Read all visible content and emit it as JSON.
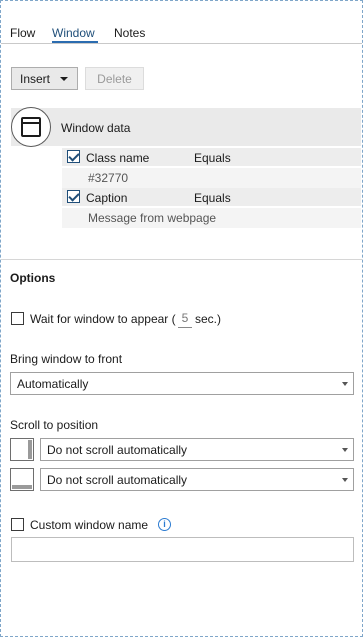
{
  "tabs": [
    {
      "label": "Flow",
      "active": false
    },
    {
      "label": "Window",
      "active": true
    },
    {
      "label": "Notes",
      "active": false
    }
  ],
  "toolbar": {
    "insert_label": "Insert",
    "delete_label": "Delete"
  },
  "window_data": {
    "title": "Window data",
    "icon": "window-icon",
    "conditions": [
      {
        "checked": true,
        "field": "Class name",
        "operator": "Equals",
        "value": "#32770"
      },
      {
        "checked": true,
        "field": "Caption",
        "operator": "Equals",
        "value": "Message from webpage"
      }
    ]
  },
  "options": {
    "heading": "Options",
    "wait": {
      "checked": false,
      "label_before": "Wait for window to appear (",
      "seconds": "5",
      "label_after": "sec.)"
    },
    "bring_to_front": {
      "label": "Bring window to front",
      "value": "Automatically"
    },
    "scroll": {
      "label": "Scroll to position",
      "vertical": {
        "icon": "vertical-scroll-icon",
        "value": "Do not scroll automatically"
      },
      "horizontal": {
        "icon": "horizontal-scroll-icon",
        "value": "Do not scroll automatically"
      }
    },
    "custom_name": {
      "checked": false,
      "label": "Custom window name",
      "info_icon": "info-icon",
      "value": ""
    }
  },
  "colors": {
    "accent": "#2b6cb0",
    "border": "#7fa6c9"
  }
}
